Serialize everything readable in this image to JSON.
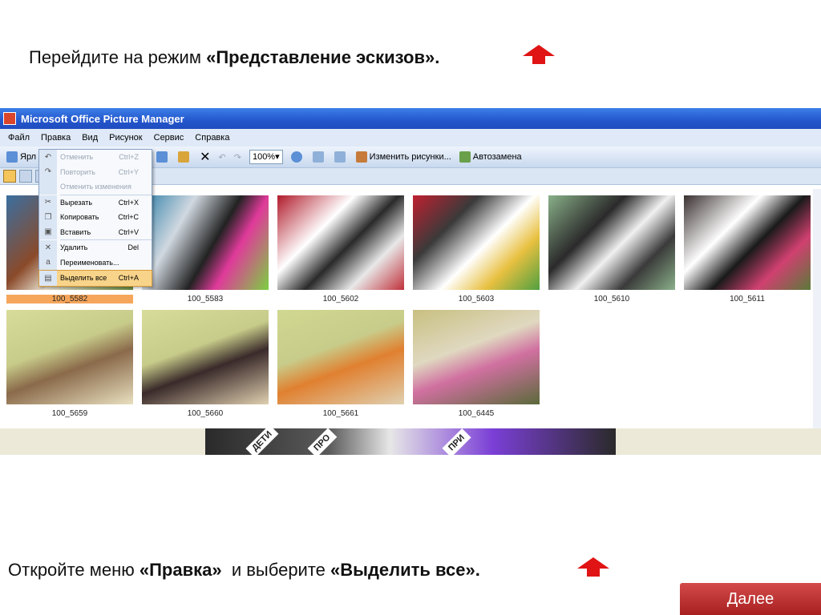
{
  "instructions": {
    "step1_prefix": "Перейдите на режим ",
    "step1_bold": "«Представление  эскизов».",
    "step2_prefix": "Откройте меню ",
    "step2_bold1": "«Правка»",
    "step2_mid": "  и выберите ",
    "step2_bold2": "«Выделить все»."
  },
  "window": {
    "title": "Microsoft Office Picture Manager"
  },
  "menubar": [
    "Файл",
    "Правка",
    "Вид",
    "Рисунок",
    "Сервис",
    "Справка"
  ],
  "toolbar": {
    "shortcut_label": "Ярл",
    "zoom": "100%",
    "edit_pictures_label": "Изменить рисунки...",
    "autocorrect_label": "Автозамена"
  },
  "edit_menu": {
    "items": [
      {
        "label": "Отменить",
        "shortcut": "Ctrl+Z",
        "icon": "undo-icon",
        "disabled": true
      },
      {
        "label": "Повторить",
        "shortcut": "Ctrl+Y",
        "icon": "redo-icon",
        "disabled": true
      },
      {
        "label": "Отменить изменения",
        "shortcut": "",
        "icon": "",
        "disabled": true
      },
      {
        "label": "Вырезать",
        "shortcut": "Ctrl+X",
        "icon": "scissors-icon",
        "disabled": false
      },
      {
        "label": "Копировать",
        "shortcut": "Ctrl+C",
        "icon": "copy-icon",
        "disabled": false
      },
      {
        "label": "Вставить",
        "shortcut": "Ctrl+V",
        "icon": "paste-icon",
        "disabled": false
      },
      {
        "label": "Удалить",
        "shortcut": "Del",
        "icon": "delete-icon",
        "disabled": false
      },
      {
        "label": "Переименовать...",
        "shortcut": "",
        "icon": "rename-icon",
        "disabled": false
      },
      {
        "label": "Выделить все",
        "shortcut": "Ctrl+A",
        "icon": "select-all-icon",
        "disabled": false,
        "highlighted": true
      }
    ]
  },
  "thumbnails": [
    {
      "name": "100_5582",
      "selected": true
    },
    {
      "name": "100_5583"
    },
    {
      "name": "100_5602"
    },
    {
      "name": "100_5603"
    },
    {
      "name": "100_5610"
    },
    {
      "name": "100_5611"
    },
    {
      "name": "100_5659"
    },
    {
      "name": "100_5660"
    },
    {
      "name": "100_5661"
    },
    {
      "name": "100_6445"
    }
  ],
  "bottom_photo_signs": [
    "ДЕТИ",
    "ПРО",
    "ПРИ"
  ],
  "next_button": "Далее",
  "colors": {
    "arrow": "#e01414",
    "titlebar": "#2456cc",
    "highlight": "#f8d48a",
    "next_button": "#c03030"
  }
}
